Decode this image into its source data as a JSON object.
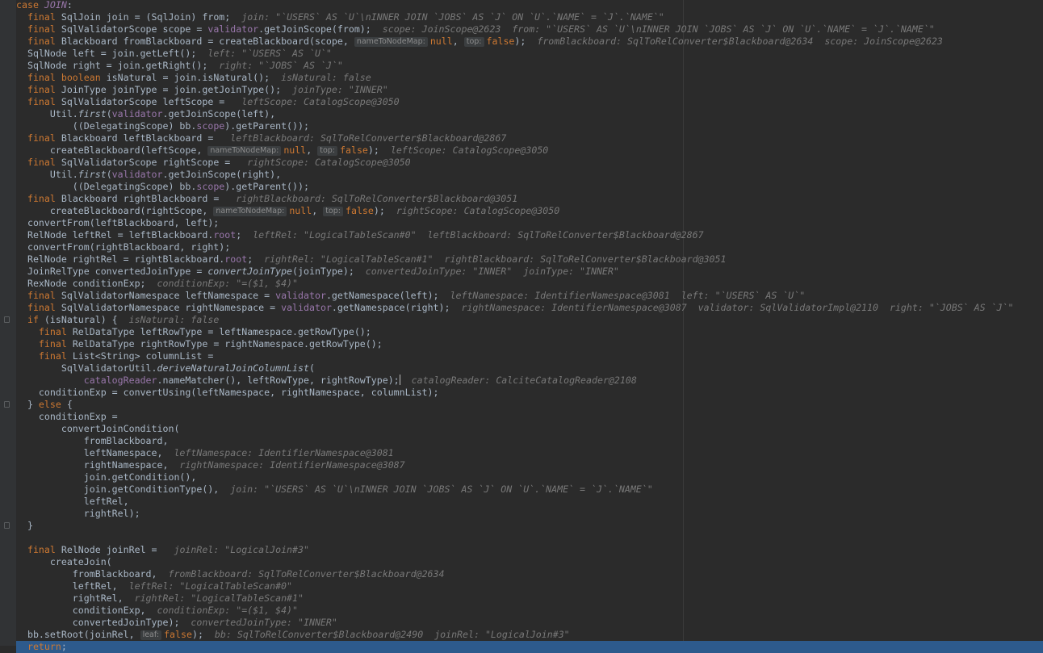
{
  "editor": {
    "lines": [
      [
        {
          "t": "case ",
          "c": "kw"
        },
        {
          "t": "JOIN",
          "c": "fld-i"
        },
        {
          "t": ":"
        }
      ],
      [
        {
          "t": "  "
        },
        {
          "t": "final ",
          "c": "kw"
        },
        {
          "t": "SqlJoin join = (SqlJoin) from;"
        },
        {
          "t": "  join: \"`USERS` AS `U`\\nINNER JOIN `JOBS` AS `J` ON `U`.`NAME` = `J`.`NAME`\"",
          "c": "t-hint"
        }
      ],
      [
        {
          "t": "  "
        },
        {
          "t": "final ",
          "c": "kw"
        },
        {
          "t": "SqlValidatorScope scope = "
        },
        {
          "t": "validator",
          "c": "fld"
        },
        {
          "t": ".getJoinScope(from);"
        },
        {
          "t": "  scope: JoinScope@2623  from: \"`USERS` AS `U`\\nINNER JOIN `JOBS` AS `J` ON `U`.`NAME` = `J`.`NAME`\"",
          "c": "t-hint"
        }
      ],
      [
        {
          "t": "  "
        },
        {
          "t": "final ",
          "c": "kw"
        },
        {
          "t": "Blackboard fromBlackboard = createBlackboard(scope, "
        },
        {
          "t": "nameToNodeMap:",
          "c": "badge"
        },
        {
          "t": "null",
          "c": "kw"
        },
        {
          "t": ", "
        },
        {
          "t": "top:",
          "c": "badge"
        },
        {
          "t": "false",
          "c": "kw"
        },
        {
          "t": ");"
        },
        {
          "t": "  fromBlackboard: SqlToRelConverter$Blackboard@2634  scope: JoinScope@2623",
          "c": "t-hint"
        }
      ],
      [
        {
          "t": "  SqlNode left = join.getLeft();"
        },
        {
          "t": "  left: \"`USERS` AS `U`\"",
          "c": "t-hint"
        }
      ],
      [
        {
          "t": "  SqlNode right = join.getRight();"
        },
        {
          "t": "  right: \"`JOBS` AS `J`\"",
          "c": "t-hint"
        }
      ],
      [
        {
          "t": "  "
        },
        {
          "t": "final boolean ",
          "c": "kw"
        },
        {
          "t": "isNatural = join.isNatural();"
        },
        {
          "t": "  isNatural: false",
          "c": "t-hint"
        }
      ],
      [
        {
          "t": "  "
        },
        {
          "t": "final ",
          "c": "kw"
        },
        {
          "t": "JoinType joinType = join.getJoinType();"
        },
        {
          "t": "  joinType: \"INNER\"",
          "c": "t-hint"
        }
      ],
      [
        {
          "t": "  "
        },
        {
          "t": "final ",
          "c": "kw"
        },
        {
          "t": "SqlValidatorScope leftScope = "
        },
        {
          "t": "  leftScope: CatalogScope@3050",
          "c": "t-hint"
        }
      ],
      [
        {
          "t": "      Util."
        },
        {
          "t": "first",
          "c": "it"
        },
        {
          "t": "("
        },
        {
          "t": "validator",
          "c": "fld"
        },
        {
          "t": ".getJoinScope(left),"
        }
      ],
      [
        {
          "t": "          ((DelegatingScope) bb."
        },
        {
          "t": "scope",
          "c": "fld"
        },
        {
          "t": ").getParent());"
        }
      ],
      [
        {
          "t": "  "
        },
        {
          "t": "final ",
          "c": "kw"
        },
        {
          "t": "Blackboard leftBlackboard = "
        },
        {
          "t": "  leftBlackboard: SqlToRelConverter$Blackboard@2867",
          "c": "t-hint"
        }
      ],
      [
        {
          "t": "      createBlackboard(leftScope, "
        },
        {
          "t": "nameToNodeMap:",
          "c": "badge"
        },
        {
          "t": "null",
          "c": "kw"
        },
        {
          "t": ", "
        },
        {
          "t": "top:",
          "c": "badge"
        },
        {
          "t": "false",
          "c": "kw"
        },
        {
          "t": ");"
        },
        {
          "t": "  leftScope: CatalogScope@3050",
          "c": "t-hint"
        }
      ],
      [
        {
          "t": "  "
        },
        {
          "t": "final ",
          "c": "kw"
        },
        {
          "t": "SqlValidatorScope rightScope = "
        },
        {
          "t": "  rightScope: CatalogScope@3050",
          "c": "t-hint"
        }
      ],
      [
        {
          "t": "      Util."
        },
        {
          "t": "first",
          "c": "it"
        },
        {
          "t": "("
        },
        {
          "t": "validator",
          "c": "fld"
        },
        {
          "t": ".getJoinScope(right),"
        }
      ],
      [
        {
          "t": "          ((DelegatingScope) bb."
        },
        {
          "t": "scope",
          "c": "fld"
        },
        {
          "t": ").getParent());"
        }
      ],
      [
        {
          "t": "  "
        },
        {
          "t": "final ",
          "c": "kw"
        },
        {
          "t": "Blackboard rightBlackboard = "
        },
        {
          "t": "  rightBlackboard: SqlToRelConverter$Blackboard@3051",
          "c": "t-hint"
        }
      ],
      [
        {
          "t": "      createBlackboard(rightScope, "
        },
        {
          "t": "nameToNodeMap:",
          "c": "badge"
        },
        {
          "t": "null",
          "c": "kw"
        },
        {
          "t": ", "
        },
        {
          "t": "top:",
          "c": "badge"
        },
        {
          "t": "false",
          "c": "kw"
        },
        {
          "t": ");"
        },
        {
          "t": "  rightScope: CatalogScope@3050",
          "c": "t-hint"
        }
      ],
      [
        {
          "t": "  convertFrom(leftBlackboard, left);"
        }
      ],
      [
        {
          "t": "  RelNode leftRel = leftBlackboard."
        },
        {
          "t": "root",
          "c": "fld"
        },
        {
          "t": ";"
        },
        {
          "t": "  leftRel: \"LogicalTableScan#0\"  leftBlackboard: SqlToRelConverter$Blackboard@2867",
          "c": "t-hint"
        }
      ],
      [
        {
          "t": "  convertFrom(rightBlackboard, right);"
        }
      ],
      [
        {
          "t": "  RelNode rightRel = rightBlackboard."
        },
        {
          "t": "root",
          "c": "fld"
        },
        {
          "t": ";"
        },
        {
          "t": "  rightRel: \"LogicalTableScan#1\"  rightBlackboard: SqlToRelConverter$Blackboard@3051",
          "c": "t-hint"
        }
      ],
      [
        {
          "t": "  JoinRelType convertedJoinType = "
        },
        {
          "t": "convertJoinType",
          "c": "it"
        },
        {
          "t": "(joinType);"
        },
        {
          "t": "  convertedJoinType: \"INNER\"  joinType: \"INNER\"",
          "c": "t-hint"
        }
      ],
      [
        {
          "t": "  RexNode conditionExp;"
        },
        {
          "t": "  conditionExp: \"=($1, $4)\"",
          "c": "t-hint"
        }
      ],
      [
        {
          "t": "  "
        },
        {
          "t": "final ",
          "c": "kw"
        },
        {
          "t": "SqlValidatorNamespace leftNamespace = "
        },
        {
          "t": "validator",
          "c": "fld"
        },
        {
          "t": ".getNamespace(left);"
        },
        {
          "t": "  leftNamespace: IdentifierNamespace@3081  left: \"`USERS` AS `U`\"",
          "c": "t-hint"
        }
      ],
      [
        {
          "t": "  "
        },
        {
          "t": "final ",
          "c": "kw"
        },
        {
          "t": "SqlValidatorNamespace rightNamespace = "
        },
        {
          "t": "validator",
          "c": "fld"
        },
        {
          "t": ".getNamespace(right);"
        },
        {
          "t": "  rightNamespace: IdentifierNamespace@3087  validator: SqlValidatorImpl@2110  right: \"`JOBS` AS `J`\"",
          "c": "t-hint"
        }
      ],
      [
        {
          "t": "  "
        },
        {
          "t": "if ",
          "c": "kw"
        },
        {
          "t": "(isNatural) {"
        },
        {
          "t": "  isNatural: false",
          "c": "t-hint"
        }
      ],
      [
        {
          "t": "    "
        },
        {
          "t": "final ",
          "c": "kw"
        },
        {
          "t": "RelDataType leftRowType = leftNamespace.getRowType();"
        }
      ],
      [
        {
          "t": "    "
        },
        {
          "t": "final ",
          "c": "kw"
        },
        {
          "t": "RelDataType rightRowType = rightNamespace.getRowType();"
        }
      ],
      [
        {
          "t": "    "
        },
        {
          "t": "final ",
          "c": "kw"
        },
        {
          "t": "List<String> columnList ="
        }
      ],
      [
        {
          "t": "        SqlValidatorUtil."
        },
        {
          "t": "deriveNaturalJoinColumnList",
          "c": "it"
        },
        {
          "t": "("
        }
      ],
      [
        {
          "t": "            "
        },
        {
          "t": "catalogReader",
          "c": "fld"
        },
        {
          "t": ".nameMatcher(), leftRowType, rightRowType);"
        },
        {
          "t": "",
          "c": "caret"
        },
        {
          "t": "  catalogReader: CalciteCatalogReader@2108",
          "c": "t-hint"
        }
      ],
      [
        {
          "t": "    conditionExp = convertUsing(leftNamespace, rightNamespace, columnList);"
        }
      ],
      [
        {
          "t": "  } "
        },
        {
          "t": "else ",
          "c": "kw"
        },
        {
          "t": "{"
        }
      ],
      [
        {
          "t": "    conditionExp ="
        }
      ],
      [
        {
          "t": "        convertJoinCondition("
        }
      ],
      [
        {
          "t": "            fromBlackboard,"
        }
      ],
      [
        {
          "t": "            leftNamespace,"
        },
        {
          "t": "  leftNamespace: IdentifierNamespace@3081",
          "c": "t-hint"
        }
      ],
      [
        {
          "t": "            rightNamespace,"
        },
        {
          "t": "  rightNamespace: IdentifierNamespace@3087",
          "c": "t-hint"
        }
      ],
      [
        {
          "t": "            join.getCondition(),"
        }
      ],
      [
        {
          "t": "            join.getConditionType(),"
        },
        {
          "t": "  join: \"`USERS` AS `U`\\nINNER JOIN `JOBS` AS `J` ON `U`.`NAME` = `J`.`NAME`\"",
          "c": "t-hint"
        }
      ],
      [
        {
          "t": "            leftRel,"
        }
      ],
      [
        {
          "t": "            rightRel);"
        }
      ],
      [
        {
          "t": "  }"
        }
      ],
      [
        {
          "t": ""
        }
      ],
      [
        {
          "t": "  "
        },
        {
          "t": "final ",
          "c": "kw"
        },
        {
          "t": "RelNode joinRel = "
        },
        {
          "t": "  joinRel: \"LogicalJoin#3\"",
          "c": "t-hint"
        }
      ],
      [
        {
          "t": "      createJoin("
        }
      ],
      [
        {
          "t": "          fromBlackboard,"
        },
        {
          "t": "  fromBlackboard: SqlToRelConverter$Blackboard@2634",
          "c": "t-hint"
        }
      ],
      [
        {
          "t": "          leftRel,"
        },
        {
          "t": "  leftRel: \"LogicalTableScan#0\"",
          "c": "t-hint"
        }
      ],
      [
        {
          "t": "          rightRel,"
        },
        {
          "t": "  rightRel: \"LogicalTableScan#1\"",
          "c": "t-hint"
        }
      ],
      [
        {
          "t": "          conditionExp,"
        },
        {
          "t": "  conditionExp: \"=($1, $4)\"",
          "c": "t-hint"
        }
      ],
      [
        {
          "t": "          convertedJoinType);"
        },
        {
          "t": "  convertedJoinType: \"INNER\"",
          "c": "t-hint"
        }
      ],
      [
        {
          "t": "  bb.setRoot(joinRel, "
        },
        {
          "t": "leaf:",
          "c": "badge"
        },
        {
          "t": "false",
          "c": "kw"
        },
        {
          "t": ");"
        },
        {
          "t": "  bb: SqlToRelConverter$Blackboard@2490  joinRel: \"LogicalJoin#3\"",
          "c": "t-hint"
        }
      ],
      [
        {
          "t": "  "
        },
        {
          "t": "return",
          "c": "kw"
        },
        {
          "t": ";"
        }
      ]
    ],
    "current_line": 53,
    "fold_markers": [
      26,
      33,
      43
    ]
  }
}
